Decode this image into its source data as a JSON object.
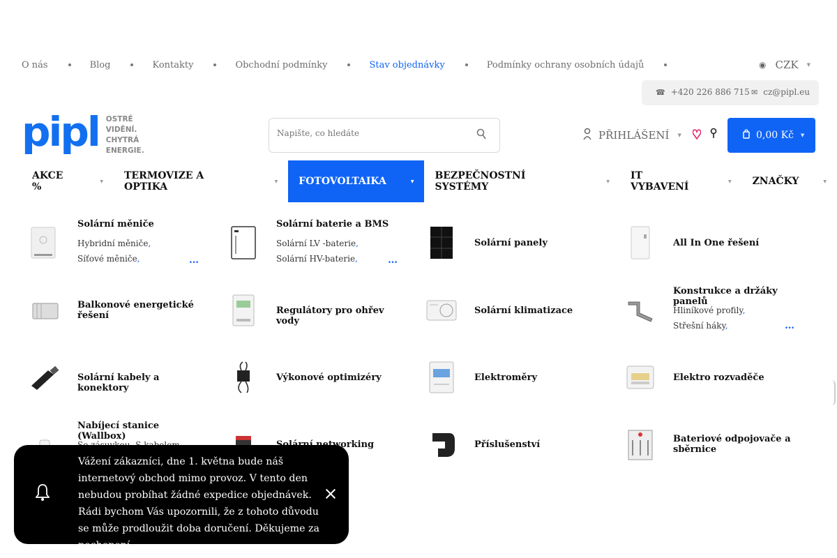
{
  "toplinks": {
    "items": [
      {
        "label": "O nás"
      },
      {
        "label": "Blog"
      },
      {
        "label": "Kontakty"
      },
      {
        "label": "Obchodní podmínky"
      },
      {
        "label": "Stav objednávky"
      },
      {
        "label": "Podmínky ochrany osobních údajů"
      }
    ],
    "active_index": 4
  },
  "currency": "CZK",
  "contact": {
    "phone": "+420 226 886 715",
    "email": "cz@pipl.eu"
  },
  "logo": {
    "word": "pipl",
    "tagline_1": "OSTRÉ VIDĚNÍ.",
    "tagline_2": "CHYTRÁ ENERGIE."
  },
  "search": {
    "placeholder": "Napište, co hledáte"
  },
  "account": {
    "login_label": "PŘIHLÁŠENÍ"
  },
  "cart": {
    "total": "0,00 Kč"
  },
  "nav": {
    "items": [
      {
        "label": "AKCE %"
      },
      {
        "label": "TERMOVIZE A OPTIKA"
      },
      {
        "label": "FOTOVOLTAIKA"
      },
      {
        "label": "BEZPEČNOSTNÍ SYSTÉMY"
      },
      {
        "label": "IT VYBAVENÍ"
      },
      {
        "label": "ZNAČKY"
      }
    ],
    "active": "FOTOVOLTAIKA"
  },
  "categories": [
    {
      "title": "Solární měniče",
      "subs": [
        "Hybridní měniče",
        "Síťové měniče"
      ],
      "icon": "inverter-icon"
    },
    {
      "title": "Solární baterie a BMS",
      "subs": [
        "Solární LV -baterie",
        "Solární HV-baterie"
      ],
      "icon": "battery-icon"
    },
    {
      "title": "Solární panely",
      "subs": [],
      "icon": "solar-panel-icon"
    },
    {
      "title": "All In One řešení",
      "subs": [],
      "icon": "all-in-one-icon"
    },
    {
      "title": "Balkonové energetické řešení",
      "subs": [],
      "icon": "balcony-icon"
    },
    {
      "title": "Regulátory pro ohřev vody",
      "subs": [],
      "icon": "regulator-icon"
    },
    {
      "title": "Solární klimatizace",
      "subs": [],
      "icon": "air-conditioner-icon"
    },
    {
      "title": "Konstrukce a držáky panelů",
      "subs": [
        "Hliníkové profily",
        "Střešní háky"
      ],
      "icon": "mount-icon"
    },
    {
      "title": "Solární kabely a konektory",
      "subs": [],
      "icon": "connector-icon"
    },
    {
      "title": "Výkonové optimizéry",
      "subs": [],
      "icon": "optimizer-icon"
    },
    {
      "title": "Elektroměry",
      "subs": [],
      "icon": "meter-icon"
    },
    {
      "title": "Elektro rozvaděče",
      "subs": [],
      "icon": "switchboard-icon"
    },
    {
      "title": "Nabíjecí stanice (Wallbox)",
      "subs": [
        "Se zásuvkou",
        "S kabelem"
      ],
      "icon": "wallbox-icon"
    },
    {
      "title": "Solární networking",
      "subs": [],
      "icon": "networking-icon"
    },
    {
      "title": "Příslušenství",
      "subs": [],
      "icon": "accessory-icon"
    },
    {
      "title": "Bateriové odpojovače a sběrnice",
      "subs": [],
      "icon": "disconnector-icon"
    }
  ],
  "notice": {
    "text": "Vážení zákazníci, dne 1. května bude náš internetový obchod mimo provoz. V tento den nebudou probíhat žádné expedice objednávek. Rádi bychom Vás upozornili, že z tohoto důvodu se může prodloužit doba doručení. Děkujeme za pochopení."
  },
  "colors": {
    "accent": "#0f64f5",
    "heart": "#e0286e",
    "toast": "#000000"
  }
}
